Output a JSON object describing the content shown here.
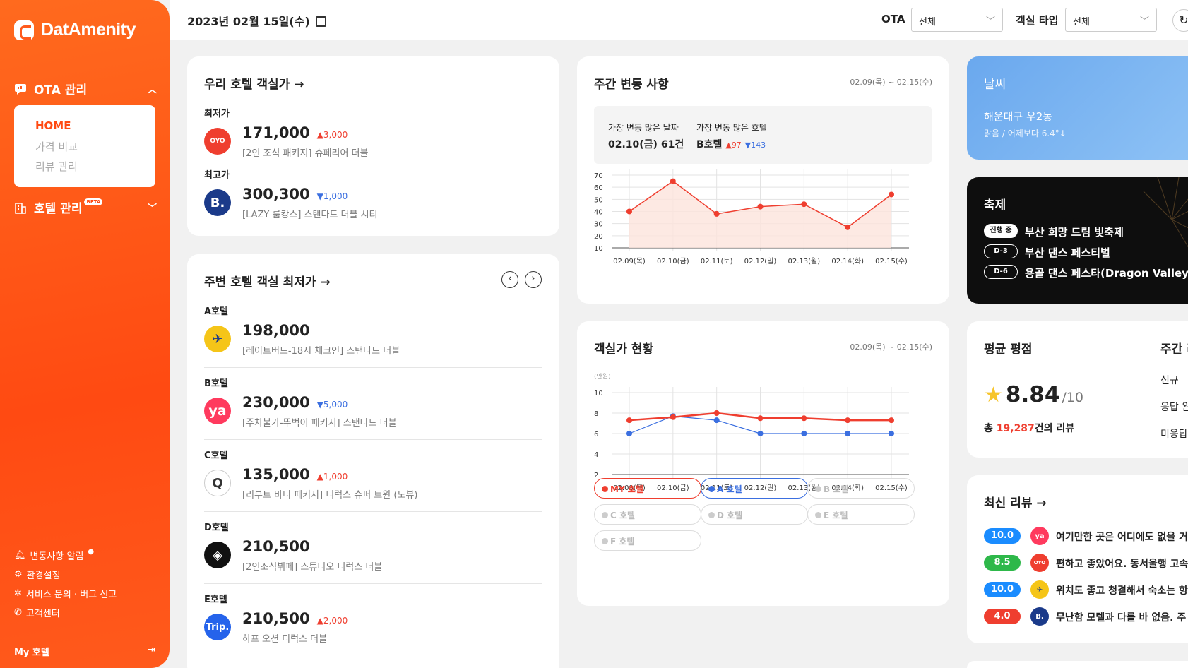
{
  "app": {
    "name": "DatAmenity"
  },
  "sidebar": {
    "ota_label": "OTA 관리",
    "ota_sub": [
      "HOME",
      "가격 비교",
      "리뷰 관리"
    ],
    "hotel_label": "호텔 관리",
    "beta": "BETA",
    "bottom": [
      "변동사항 알림",
      "환경설정",
      "서비스 문의 · 버그 신고",
      "고객센터"
    ],
    "my_hotel": "My 호텔"
  },
  "topbar": {
    "date": "2023년 02월 15일(수)",
    "ota_label": "OTA",
    "ota_value": "전체",
    "room_label": "객실 타입",
    "room_value": "전체"
  },
  "our_price": {
    "title": "우리 호텔 객실가 →",
    "min_label": "최저가",
    "min_price": "171,000",
    "min_delta": "▲3,000",
    "min_desc": "[2인 조식 패키지] 슈페리어 더블",
    "min_logo": "OYO",
    "max_label": "최고가",
    "max_price": "300,300",
    "max_delta": "▼1,000",
    "max_desc": "[LAZY 룸캉스] 스탠다드 더블 시티",
    "max_logo": "B."
  },
  "nearby": {
    "title": "주변 호텔 객실 최저가 →",
    "hotels": [
      {
        "name": "A호텔",
        "price": "198,000",
        "delta": "-",
        "desc": "[레이트버드-18시 체크인] 스탠다드 더블",
        "logo": "✈"
      },
      {
        "name": "B호텔",
        "price": "230,000",
        "delta": "▼5,000",
        "desc": "[주차불가-뚜벅이 패키지] 스탠다드 더블",
        "logo": "ya"
      },
      {
        "name": "C호텔",
        "price": "135,000",
        "delta": "▲1,000",
        "desc": "[리부트 바디 패키지] 디럭스 슈퍼 트윈 (노뷰)",
        "logo": "Q"
      },
      {
        "name": "D호텔",
        "price": "210,500",
        "delta": "-",
        "desc": "[2인조식뷔페] 스튜디오 디럭스 더블",
        "logo": "◈"
      },
      {
        "name": "E호텔",
        "price": "210,500",
        "delta": "▲2,000",
        "desc": "하프 오션 디럭스 더블",
        "logo": "Trip."
      }
    ]
  },
  "weekly": {
    "title": "주간 변동 사항",
    "range": "02.09(목) ~ 02.15(수)",
    "most_date_label": "가장 변동 많은 날짜",
    "most_date": "02.10(금) 61건",
    "most_hotel_label": "가장 변동 많은 호텔",
    "most_hotel": "B호텔",
    "up": "▲97",
    "down": "▼143"
  },
  "price_status": {
    "title": "객실가 현황",
    "range": "02.09(목) ~ 02.15(수)",
    "unit": "(만원)",
    "chips": [
      "MY 호텔",
      "A 호텔",
      "B 호텔",
      "C 호텔",
      "D 호텔",
      "E 호텔",
      "F 호텔"
    ]
  },
  "weather": {
    "title": "날씨",
    "location": "해운대구 우2동",
    "desc": "맑음 / 어제보다 6.4°↓"
  },
  "festival": {
    "title": "축제",
    "items": [
      {
        "tag": "진행 중",
        "name": "부산 희망 드림 빛축제"
      },
      {
        "tag": "D-3",
        "name": "부산 댄스 페스티벌"
      },
      {
        "tag": "D-6",
        "name": "용골 댄스 페스타(Dragon Valley Da"
      }
    ]
  },
  "rating": {
    "title": "평균 평점",
    "score": "8.84",
    "out_of": "/10",
    "total_prefix": "총 ",
    "total": "19,287",
    "total_suffix": "건의 리뷰",
    "weekly_title": "주간 리",
    "weekly_items": [
      "신규",
      "응답 완",
      "미응답"
    ]
  },
  "reviews": {
    "title": "최신 리뷰 →",
    "items": [
      {
        "score": "10.0",
        "color": "#1a8cff",
        "logo": "ya",
        "text": "여기만한 곳은 어디에도 없을 거"
      },
      {
        "score": "8.5",
        "color": "#2eb84a",
        "logo": "OYO",
        "text": "편하고 좋았어요. 동서울행 고속"
      },
      {
        "score": "10.0",
        "color": "#1a8cff",
        "logo": "✈",
        "text": "위치도 좋고 청결해서 숙소는 항"
      },
      {
        "score": "4.0",
        "color": "#ef3e2f",
        "logo": "B.",
        "text": "무난함 모텔과 다를 바 없음. 주"
      }
    ]
  },
  "chart_data": [
    {
      "type": "area",
      "title": "주간 변동 사항",
      "x": [
        "02.09(목)",
        "02.10(금)",
        "02.11(토)",
        "02.12(일)",
        "02.13(월)",
        "02.14(화)",
        "02.15(수)"
      ],
      "values": [
        40,
        65,
        38,
        44,
        46,
        27,
        54
      ],
      "ylim": [
        10,
        70
      ],
      "yticks": [
        10,
        20,
        30,
        40,
        50,
        60,
        70
      ]
    },
    {
      "type": "line",
      "title": "객실가 현황",
      "x": [
        "02.09(목)",
        "02.10(금)",
        "02.11(토)",
        "02.12(일)",
        "02.13(월)",
        "02.14(화)",
        "02.15(수)"
      ],
      "ylabel": "(만원)",
      "ylim": [
        2,
        10
      ],
      "yticks": [
        2,
        4,
        6,
        8,
        10
      ],
      "series": [
        {
          "name": "MY 호텔",
          "values": [
            7.3,
            7.6,
            8.0,
            7.5,
            7.5,
            7.3,
            7.3
          ]
        },
        {
          "name": "A 호텔",
          "values": [
            6.0,
            7.7,
            7.3,
            6.0,
            6.0,
            6.0,
            6.0
          ]
        }
      ]
    }
  ],
  "colors": {
    "accent": "#ff4a12",
    "my_hotel": "#ef3e2f",
    "a_hotel": "#3b6fe0"
  }
}
